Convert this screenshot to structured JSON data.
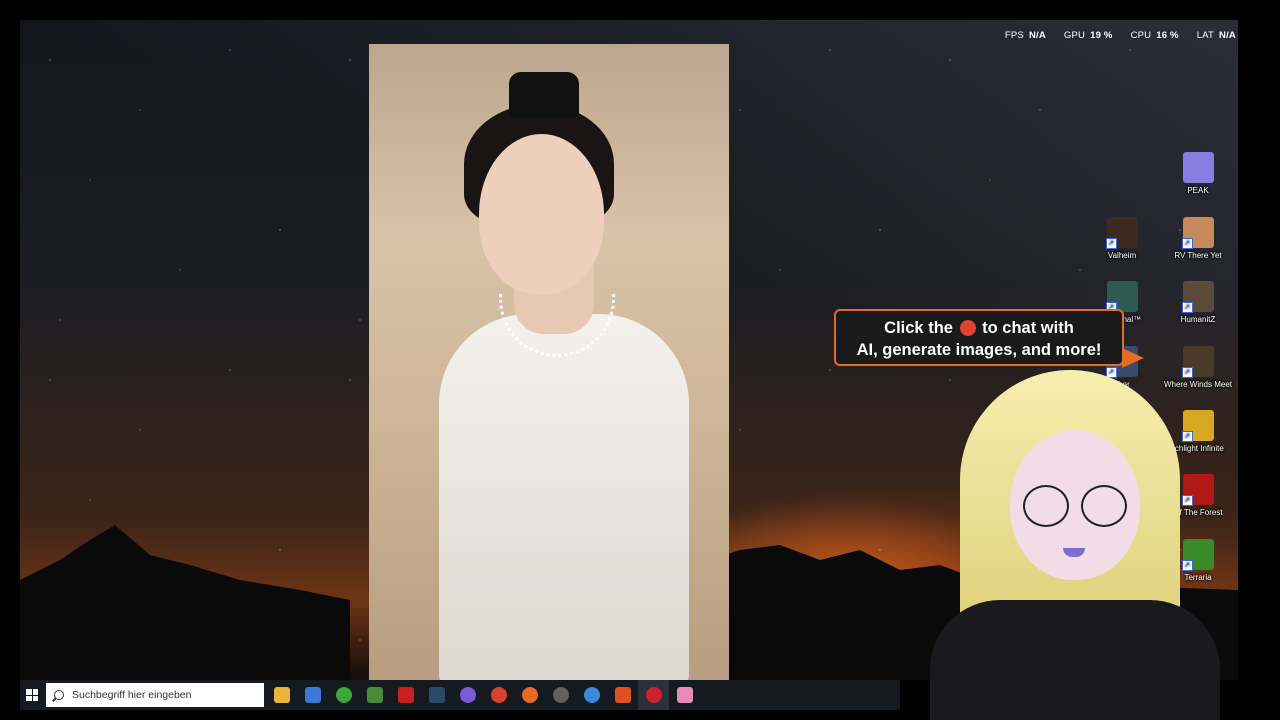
{
  "stats": [
    {
      "label": "FPS",
      "value": "N/A"
    },
    {
      "label": "GPU",
      "value": "19 %"
    },
    {
      "label": "CPU",
      "value": "16 %"
    },
    {
      "label": "LAT",
      "value": "N/A"
    }
  ],
  "desktop_icons": [
    {
      "label": "PEAK",
      "icon": "peak-icon",
      "color": "#8a7de0"
    },
    {
      "label": "Valheim",
      "icon": "valheim-icon",
      "color": "#3a2a20"
    },
    {
      "label": "RV There Yet",
      "icon": "rv-there-yet-icon",
      "color": "#c88a5a"
    },
    {
      "label": "Returnal™",
      "icon": "returnal-icon",
      "color": "#2f5a54"
    },
    {
      "label": "HumanitZ",
      "icon": "humanitz-icon",
      "color": "#5a4a3a"
    },
    {
      "label": "cher",
      "icon": "launcher-icon",
      "color": "#3a4a6a"
    },
    {
      "label": "Where Winds Meet",
      "icon": "where-winds-meet-icon",
      "color": "#4a3a2a"
    },
    {
      "label": "rchlight Infinite",
      "icon": "torchlight-infinite-icon",
      "color": "#d8a820"
    },
    {
      "label": "Of The Forest",
      "icon": "sons-of-the-forest-icon",
      "color": "#b01818"
    },
    {
      "label": "Terraria",
      "icon": "terraria-icon",
      "color": "#3a8a2a"
    }
  ],
  "callout": {
    "line1_before": "Click the",
    "line1_after": "to chat with",
    "line2": "AI, generate images, and more!",
    "icon": "chat-orb-icon",
    "accent": "#e36b2a"
  },
  "taskbar": {
    "search_placeholder": "Suchbegriff hier eingeben",
    "apps": [
      {
        "name": "file-explorer",
        "color": "#e8b53a",
        "glyph": ""
      },
      {
        "name": "microsoft-store",
        "color": "#3a7ad6",
        "glyph": ""
      },
      {
        "name": "xbox-app",
        "color": "#3aa83a",
        "glyph": ""
      },
      {
        "name": "minecraft-launcher",
        "color": "#4a8a3a",
        "glyph": ""
      },
      {
        "name": "red-app",
        "color": "#c82020",
        "glyph": ""
      },
      {
        "name": "steam",
        "color": "#2a4a6a",
        "glyph": ""
      },
      {
        "name": "chat-app",
        "color": "#7a5ad8",
        "glyph": ""
      },
      {
        "name": "chrome",
        "color": "#d84030",
        "glyph": ""
      },
      {
        "name": "firefox",
        "color": "#e86a20",
        "glyph": ""
      },
      {
        "name": "disk-tool",
        "color": "#606060",
        "glyph": ""
      },
      {
        "name": "sync-app",
        "color": "#3a8ad8",
        "glyph": ""
      },
      {
        "name": "brave",
        "color": "#e05020",
        "glyph": ""
      },
      {
        "name": "opera",
        "color": "#d02030",
        "glyph": ""
      },
      {
        "name": "pink-app",
        "color": "#e88ab8",
        "glyph": ""
      }
    ]
  }
}
